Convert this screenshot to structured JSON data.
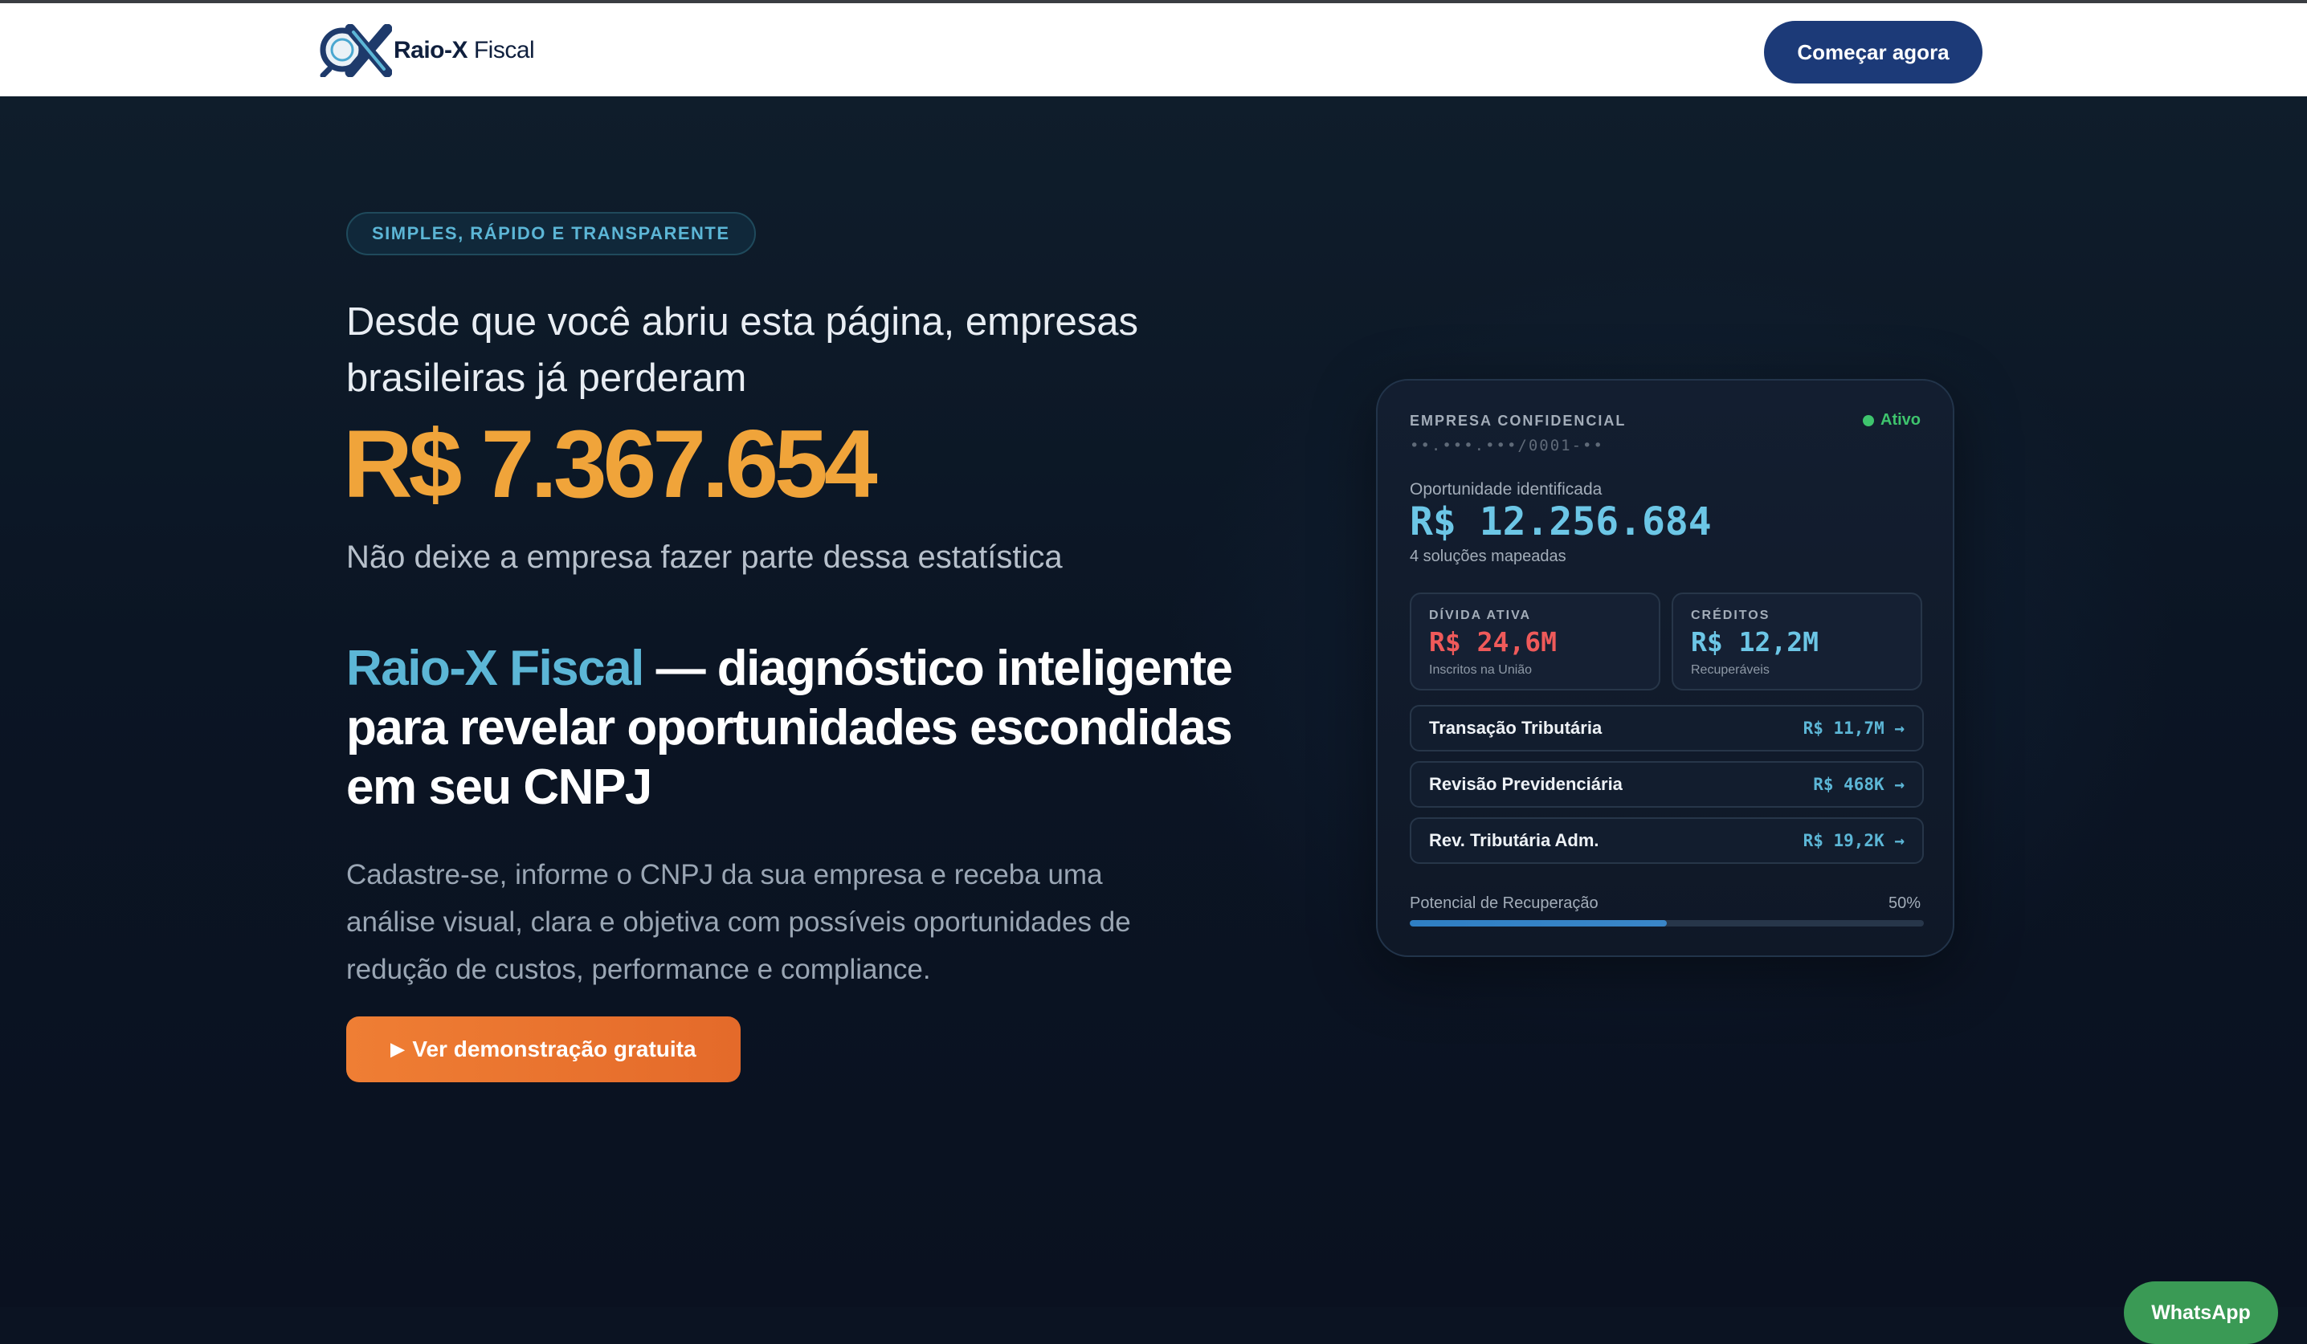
{
  "nav": {
    "logo_text_bold": "Raio-X",
    "logo_text_light": " Fiscal",
    "cta_label": "Começar agora"
  },
  "hero": {
    "badge": "SIMPLES, RÁPIDO E TRANSPARENTE",
    "lead": "Desde que você abriu esta página, empresas brasileiras já perderam",
    "counter": "R$ 7.367.654",
    "sub": "Não deixe a empresa fazer parte dessa estatística",
    "headline_brand": "Raio-X Fiscal",
    "headline_rest": " — diagnóstico inteligente para revelar oportunidades escondidas em seu CNPJ",
    "description": "Cadastre-se, informe o CNPJ da sua empresa e receba uma análise visual, clara e objetiva com possíveis oportunidades de redução de custos, performance e compliance.",
    "demo_icon": "play-icon",
    "demo_label": "Ver demonstração gratuita"
  },
  "card": {
    "label": "EMPRESA CONFIDENCIAL",
    "cnpj_mask": "••.•••.•••/0001-••",
    "status": "Ativo",
    "opportunity_label": "Oportunidade identificada",
    "opportunity_value": "R$ 12.256.684",
    "opportunity_sub": "4 soluções mapeadas",
    "stats": [
      {
        "label": "DÍVIDA ATIVA",
        "value": "R$ 24,6M",
        "note": "Inscritos na União",
        "color": "#ef5a5a"
      },
      {
        "label": "CRÉDITOS",
        "value": "R$ 12,2M",
        "note": "Recuperáveis",
        "color": "#6cc6e6"
      }
    ],
    "rows": [
      {
        "label": "Transação Tributária",
        "value": "R$ 11,7M →"
      },
      {
        "label": "Revisão Previdenciária",
        "value": "R$ 468K →"
      },
      {
        "label": "Rev. Tributária Adm.",
        "value": "R$ 19,2K →"
      }
    ],
    "potential_label": "Potencial de Recuperação",
    "potential_value": "50%",
    "potential_fraction": 0.5
  },
  "whatsapp_label": "WhatsApp",
  "colors": {
    "accent_orange": "#f0a43a",
    "brand_blue": "#5cb6d6",
    "nav_button": "#1c3a78",
    "whatsapp": "#3a9a55"
  }
}
